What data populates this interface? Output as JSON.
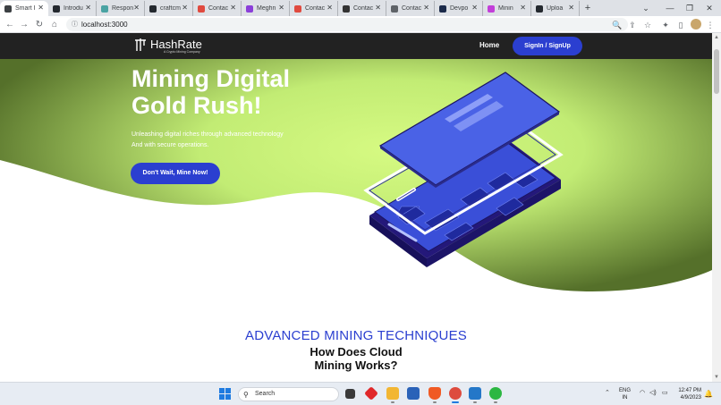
{
  "browser": {
    "tabs": [
      {
        "title": "Smart I",
        "favicon_color": "#3c4043",
        "active": true
      },
      {
        "title": "Introdu",
        "favicon_color": "#24292f"
      },
      {
        "title": "Respon",
        "favicon_color": "#4aa3a3"
      },
      {
        "title": "craftcm",
        "favicon_color": "#24292f"
      },
      {
        "title": "Contac",
        "favicon_color": "#e04a3f"
      },
      {
        "title": "Meghn",
        "favicon_color": "#8b3fd9"
      },
      {
        "title": "Contac",
        "favicon_color": "#e04a3f"
      },
      {
        "title": "Contac",
        "favicon_color": "#333333"
      },
      {
        "title": "Contac",
        "favicon_color": "#5f6368"
      },
      {
        "title": "Devpo",
        "favicon_color": "#1b2a4a"
      },
      {
        "title": "Minin",
        "favicon_color": "#c23fd9"
      },
      {
        "title": "Uploa",
        "favicon_color": "#24292f"
      }
    ],
    "new_tab": "+",
    "window_controls": {
      "menu": "⌄",
      "minimize": "—",
      "maximize": "❐",
      "close": "✕"
    },
    "address": "localhost:3000",
    "icons": {
      "back": "←",
      "forward": "→",
      "reload": "↻",
      "home": "⌂",
      "info": "ⓘ",
      "zoom": "🔍",
      "share": "⇪",
      "bookmark": "☆",
      "extensions": "✦",
      "sidebar": "▯",
      "menu": "⋮"
    }
  },
  "site": {
    "brand": {
      "name": "HashRate",
      "tagline": "A Crypto Mining Company"
    },
    "nav": {
      "home": "Home",
      "signin": "SignIn / SignUp"
    },
    "hero": {
      "title": "Mining Digital Gold Rush!",
      "subtitle_line1": "Unleashing digital riches through advanced technology",
      "subtitle_line2": "And with secure operations.",
      "cta": "Don't Wait, Mine Now!"
    },
    "section": {
      "heading": "ADVANCED MINING TECHNIQUES",
      "title_line1": "How Does Cloud",
      "title_line2": "Mining Works?"
    },
    "colors": {
      "accent": "#2b3fd0",
      "hero_green": "#c6f07a",
      "hero_dark": "#5d7a2a",
      "nav_bg": "#222222"
    }
  },
  "taskbar": {
    "search_placeholder": "Search",
    "apps": [
      "file-explorer",
      "task-view",
      "app-red",
      "folder",
      "store",
      "brave",
      "chrome",
      "vscode",
      "whatsapp"
    ],
    "language": {
      "line1": "ENG",
      "line2": "IN"
    },
    "time": "12:47 PM",
    "date": "4/9/2023",
    "tray_icons": {
      "chevron": "⌃",
      "wifi": "◠",
      "volume": "◁)",
      "battery": "▭",
      "bell": "🔔"
    }
  }
}
